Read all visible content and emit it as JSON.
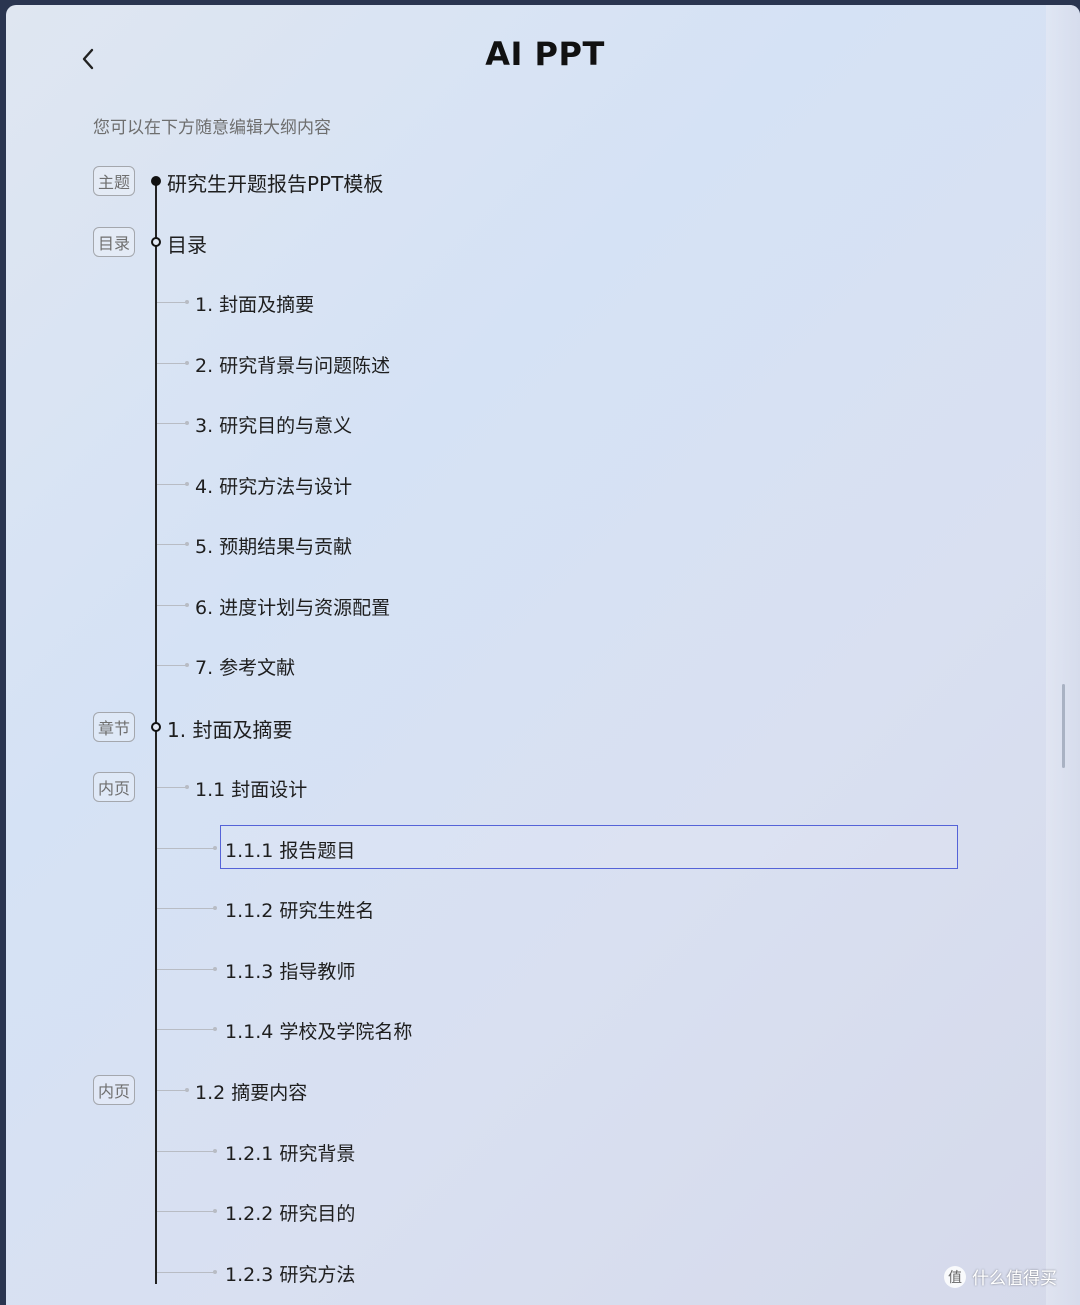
{
  "header": {
    "title": "AI PPT",
    "back_icon": "chevron-left-icon"
  },
  "hint": "您可以在下方随意编辑大纲内容",
  "tags": {
    "theme": "主题",
    "toc": "目录",
    "chapter": "章节",
    "inner_page": "内页"
  },
  "outline": {
    "theme_title": "研究生开题报告PPT模板",
    "toc_title": "目录",
    "toc_items": [
      "1. 封面及摘要",
      "2. 研究背景与问题陈述",
      "3. 研究目的与意义",
      "4. 研究方法与设计",
      "5. 预期结果与贡献",
      "6. 进度计划与资源配置",
      "7. 参考文献"
    ],
    "chapter_title": "1. 封面及摘要",
    "section1": {
      "title": "1.1 封面设计",
      "items": [
        "1.1.1 报告题目",
        "1.1.2 研究生姓名",
        "1.1.3 指导教师",
        "1.1.4 学校及学院名称"
      ]
    },
    "section2": {
      "title": "1.2 摘要内容",
      "items": [
        "1.2.1 研究背景",
        "1.2.2 研究目的",
        "1.2.3 研究方法"
      ]
    }
  },
  "watermark": {
    "text": "什么值得买",
    "icon_char": "值"
  },
  "colors": {
    "selection_border": "#5563d8",
    "tag_border": "#a4a7ad"
  }
}
